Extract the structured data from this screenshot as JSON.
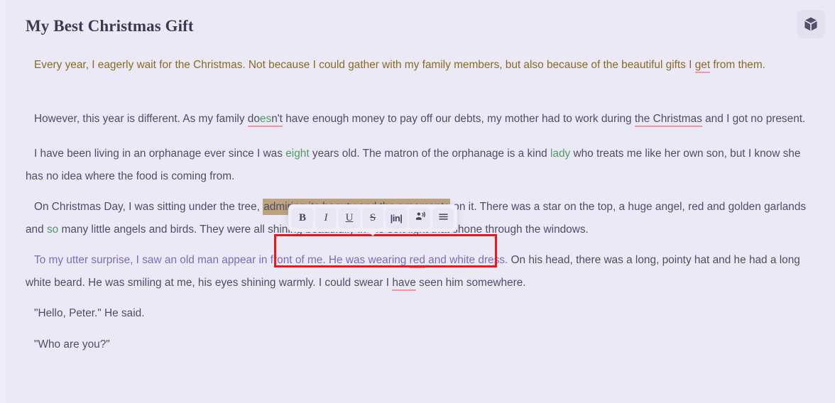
{
  "document": {
    "title": "My Best Christmas Gift",
    "paragraphs": [
      {
        "id": "p1",
        "style": "gold",
        "runs": [
          {
            "text": "Every year, I eagerly wait for the Christmas. Not because I could gather with my family members, but also because of the beautiful gifts I "
          },
          {
            "text": "get",
            "mark": "error"
          },
          {
            "text": " from them."
          }
        ]
      },
      {
        "id": "p2",
        "style": "normal",
        "runs": [
          {
            "text": "However, this year is different. As my family "
          },
          {
            "text": "do",
            "mark": "error"
          },
          {
            "text": "es",
            "mark": "error-green"
          },
          {
            "text": "n't",
            "mark": "error"
          },
          {
            "text": " have enough money to pay off our debts, my mother had to work during "
          },
          {
            "text": "the Christmas",
            "mark": "error"
          },
          {
            "text": " and I got no present."
          }
        ]
      },
      {
        "id": "p3",
        "style": "normal",
        "runs": [
          {
            "text": "I have been living in an orphanage ever since I was "
          },
          {
            "text": "eight",
            "mark": "green"
          },
          {
            "text": " years old. The matron of the orphanage is a kind "
          },
          {
            "text": "lady",
            "mark": "green"
          },
          {
            "text": " who treats me like her own son, but I know she has no idea where the food is coming from."
          }
        ]
      },
      {
        "id": "p4",
        "style": "normal",
        "runs": [
          {
            "text": "On Christmas Day, I was sitting under the tree, "
          },
          {
            "text": "admiring its beauty and the ornaments",
            "mark": "selected"
          },
          {
            "text": " on it. There was a star on the top, a huge angel, red and golden garlands and "
          },
          {
            "text": "so",
            "mark": "green"
          },
          {
            "text": " many little angels and birds. They were all shining beautifully in the soft light that shone through the windows."
          }
        ]
      },
      {
        "id": "p5",
        "style": "normal",
        "runs": [
          {
            "text": "To my utter surprise, I saw an old man appear in front of me. He was wearing ",
            "mark": "purple"
          },
          {
            "text": "red",
            "mark": "purple-error"
          },
          {
            "text": " and white dress.",
            "mark": "purple"
          },
          {
            "text": " On his head, there was a long, pointy hat and he had a long white beard. He was smiling at me, his eyes shining warmly. I could swear I "
          },
          {
            "text": "have",
            "mark": "error"
          },
          {
            "text": " seen him somewhere."
          }
        ]
      },
      {
        "id": "p6",
        "style": "normal",
        "runs": [
          {
            "text": "\"Hello, Peter.\" He said."
          }
        ]
      },
      {
        "id": "p7",
        "style": "normal",
        "runs": [
          {
            "text": "\"Who are you?\""
          }
        ]
      }
    ]
  },
  "format_toolbar": {
    "buttons": [
      {
        "name": "bold-button",
        "label": "B",
        "icon": "bold-icon"
      },
      {
        "name": "italic-button",
        "label": "I",
        "icon": "italic-icon"
      },
      {
        "name": "underline-button",
        "label": "U",
        "icon": "underline-icon"
      },
      {
        "name": "strikethrough-button",
        "label": "S",
        "icon": "strikethrough-icon"
      },
      {
        "name": "inline-code-button",
        "label": "|in|",
        "icon": "inline-code-icon"
      },
      {
        "name": "read-aloud-button",
        "label": "",
        "icon": "person-speaking-icon"
      },
      {
        "name": "list-menu-button",
        "label": "",
        "icon": "hamburger-menu-icon"
      }
    ]
  },
  "header": {
    "cube_button_label": "",
    "cube_button_icon": "cube-3d-icon"
  },
  "annotation": {
    "type": "rectangle-highlight",
    "color": "#e8181c",
    "target": "admiring its beauty and the ornaments"
  },
  "colors": {
    "page_background": "#ebe9f5",
    "title_text": "#3b3a56",
    "body_text": "#4e4d69",
    "gold_text": "#8a6a22",
    "purple_text": "#7b6bbf",
    "green_suggestion": "#4f9b62",
    "error_underline": "#f6939f",
    "selection_background": "#bda37f",
    "annotation_red": "#e8181c",
    "toolbar_background": "#f0eef8"
  }
}
